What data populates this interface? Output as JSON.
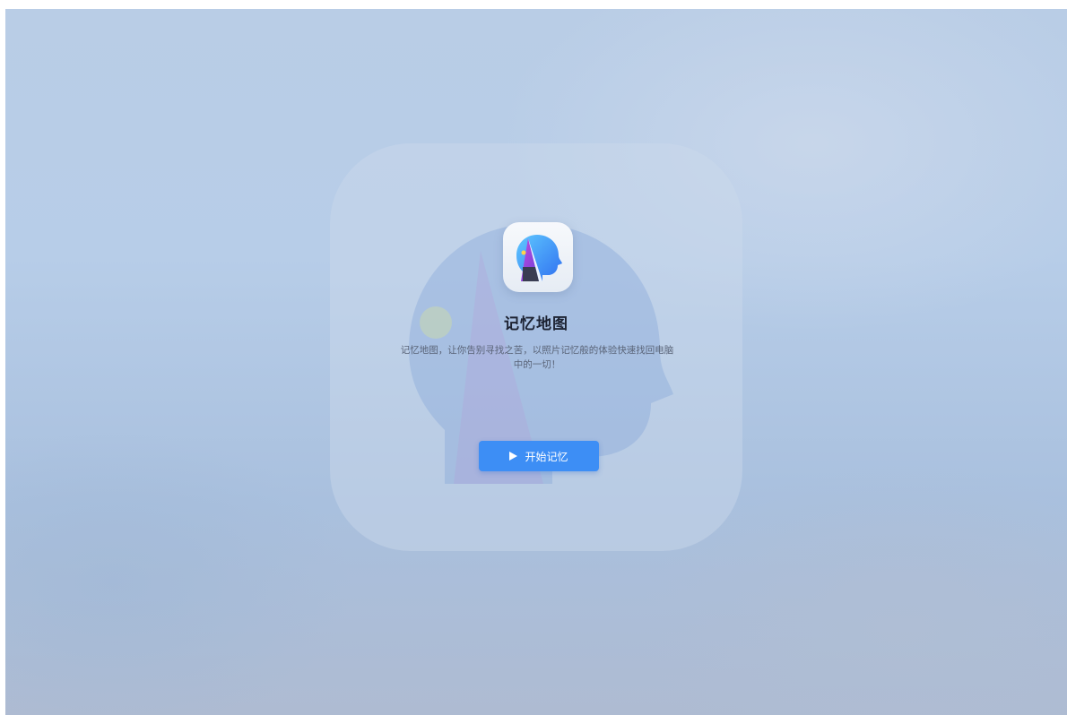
{
  "app": {
    "title": "记忆地图",
    "description": "记忆地图，让你告别寻找之苦，以照片记忆般的体验快速找回电脑中的一切！",
    "icon": "head-map-icon"
  },
  "actions": {
    "start_label": "开始记忆",
    "start_icon": "play-icon"
  },
  "colors": {
    "accent": "#3d8ef5",
    "background": "#b7cde8",
    "title": "#1d2333"
  }
}
